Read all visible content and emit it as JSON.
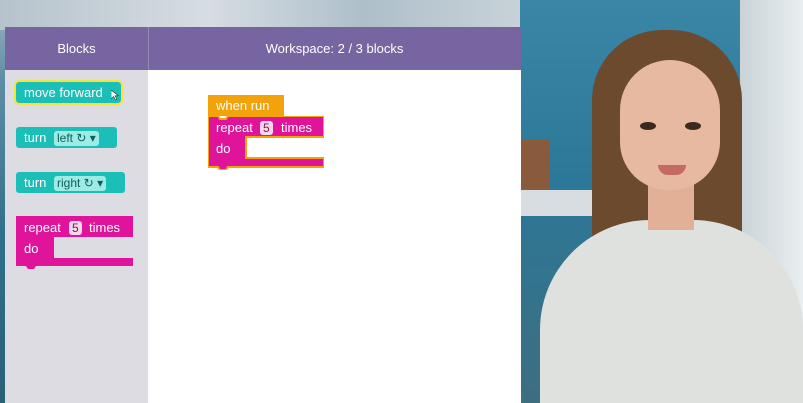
{
  "header": {
    "blocks_title": "Blocks",
    "workspace_title": "Workspace: 2 / 3 blocks"
  },
  "toolbox": {
    "move_forward": "move forward",
    "turn_left": {
      "word": "turn",
      "option": "left ↻ ▾"
    },
    "turn_right": {
      "word": "turn",
      "option": "right ↻ ▾"
    },
    "repeat": {
      "word": "repeat",
      "count": "5",
      "suffix": "times",
      "do": "do"
    }
  },
  "workspace": {
    "when_run": "when run",
    "repeat": {
      "word": "repeat",
      "count": "5",
      "suffix": "times",
      "do": "do"
    }
  },
  "colors": {
    "header": "#7665a0",
    "teal": "#1cbfb7",
    "magenta": "#e0149a",
    "orange": "#f2a20b",
    "toolbox_bg": "#dedce3"
  }
}
